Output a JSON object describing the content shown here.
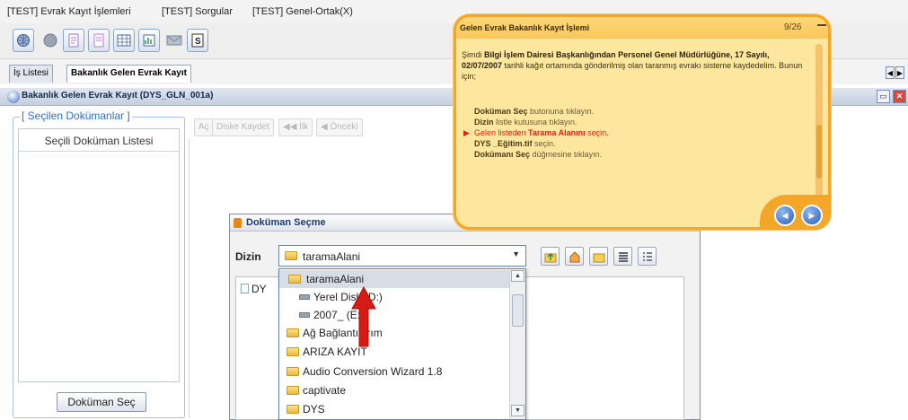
{
  "menu": [
    "[TEST] Evrak Kayıt İşlemleri",
    "[TEST] Sorgular",
    "[TEST] Genel-Ortak(X)"
  ],
  "toolbar": {
    "icons": [
      "globe-icon",
      "circle-icon",
      "document-icon",
      "document-icon",
      "grid-icon",
      "report-icon",
      "envelope-icon",
      "scan-icon"
    ]
  },
  "tabs": [
    "İş Listesi",
    "Bakanlık Gelen Evrak Kayıt"
  ],
  "window": {
    "title": "Bakanlık Gelen Evrak Kayıt (DYS_GLN_001a)"
  },
  "left_panel": {
    "legend": "[ Seçilen Dokümanlar ]",
    "list_header": "Seçili Doküman Listesi",
    "button": "Doküman Seç"
  },
  "action_bar": {
    "buttons": [
      "Aç",
      "Diske Kaydet",
      "◀◀ İlk",
      "◀ Önceki"
    ]
  },
  "dialog": {
    "title": "Doküman Seçme",
    "close": "x",
    "dir_label": "Dizin",
    "dir_value": "taramaAlani",
    "file_visible": "DY",
    "dropdown": [
      {
        "label": "taramaAlani",
        "icon": "folder-icon",
        "selected": true
      },
      {
        "label": "Yerel Disk (D:)",
        "icon": "drive-icon",
        "selected": false
      },
      {
        "label": "2007_ (E:)",
        "icon": "drive-icon",
        "selected": false
      },
      {
        "label": "Ağ Bağlantılarım",
        "icon": "folder-icon",
        "selected": false
      },
      {
        "label": "ARIZA KAYIT",
        "icon": "folder-icon",
        "selected": false
      },
      {
        "label": "Audio Conversion Wizard 1.8",
        "icon": "folder-icon",
        "selected": false
      },
      {
        "label": "captivate",
        "icon": "folder-icon",
        "selected": false
      },
      {
        "label": "DYS",
        "icon": "folder-icon",
        "selected": false
      }
    ]
  },
  "callout": {
    "title": "Gelen Evrak Bakanlık Kayıt İşlemi",
    "page": "9/26",
    "intro_1": "Şimdi ",
    "intro_bold": "Bilgi İşlem Dairesi Başkanlığından Personel Genel Müdürlüğüne, 17 Sayılı, 02/07/2007",
    "intro_2": " tarihli kağıt ortamında gönderilmiş olan taranmış evrakı sisteme kaydedelim. Bunun için;",
    "steps": [
      {
        "bold": "Doküman Seç",
        "text": " butonuna tıklayın.",
        "active": false
      },
      {
        "bold": "Dizin",
        "text": " listle kutusuna tıklayın.",
        "active": false
      },
      {
        "pre": "Gelen listeden ",
        "bold": "Tarama Alanını",
        "text": " seçin.",
        "active": true
      },
      {
        "bold": "DYS _Eğitim.tif",
        "text": " seçin.",
        "active": false
      },
      {
        "bold": "Dokümanı Seç",
        "text": " düğmesine tıklayın.",
        "active": false
      }
    ],
    "accent": "#f4a62a"
  }
}
